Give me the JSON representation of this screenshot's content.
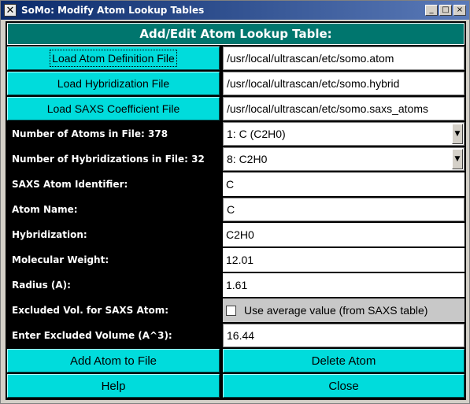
{
  "window": {
    "title": "SoMo: Modify Atom Lookup Tables",
    "controls": {
      "minimize": "_",
      "maximize": "□",
      "close": "×"
    }
  },
  "header": {
    "title": "Add/Edit Atom Lookup Table:"
  },
  "files": [
    {
      "button": "Load Atom Definition File",
      "path": "/usr/local/ultrascan/etc/somo.atom"
    },
    {
      "button": "Load Hybridization File",
      "path": "/usr/local/ultrascan/etc/somo.hybrid"
    },
    {
      "button": "Load SAXS Coefficient File",
      "path": "/usr/local/ultrascan/etc/somo.saxs_atoms"
    }
  ],
  "atoms": {
    "label": "Number of Atoms in File: 378",
    "selected": "1: C (C2H0)"
  },
  "hybrids": {
    "label": "Number of Hybridizations in File: 32",
    "selected": "8: C2H0"
  },
  "fields": {
    "saxs_id": {
      "label": "SAXS Atom Identifier:",
      "value": "C"
    },
    "atom_name": {
      "label": "Atom Name:",
      "value": "C"
    },
    "hybridization": {
      "label": "Hybridization:",
      "value": "C2H0"
    },
    "mol_weight": {
      "label": "Molecular Weight:",
      "value": "12.01"
    },
    "radius": {
      "label": "Radius (A):",
      "value": "1.61"
    },
    "excluded_vol": {
      "label": "Excluded Vol. for SAXS Atom:",
      "checkbox_label": "Use average value (from SAXS table)",
      "checked": false
    },
    "enter_excl_vol": {
      "label": "Enter Excluded Volume (A^3):",
      "value": "16.44"
    }
  },
  "actions": {
    "add": "Add Atom to File",
    "delete": "Delete Atom",
    "help": "Help",
    "close": "Close"
  },
  "colors": {
    "accent": "#00dcdc",
    "header": "#00766e",
    "panel": "#000000"
  },
  "icons": {
    "app": "x-window-icon",
    "dropdown": "chevron-down-icon"
  }
}
